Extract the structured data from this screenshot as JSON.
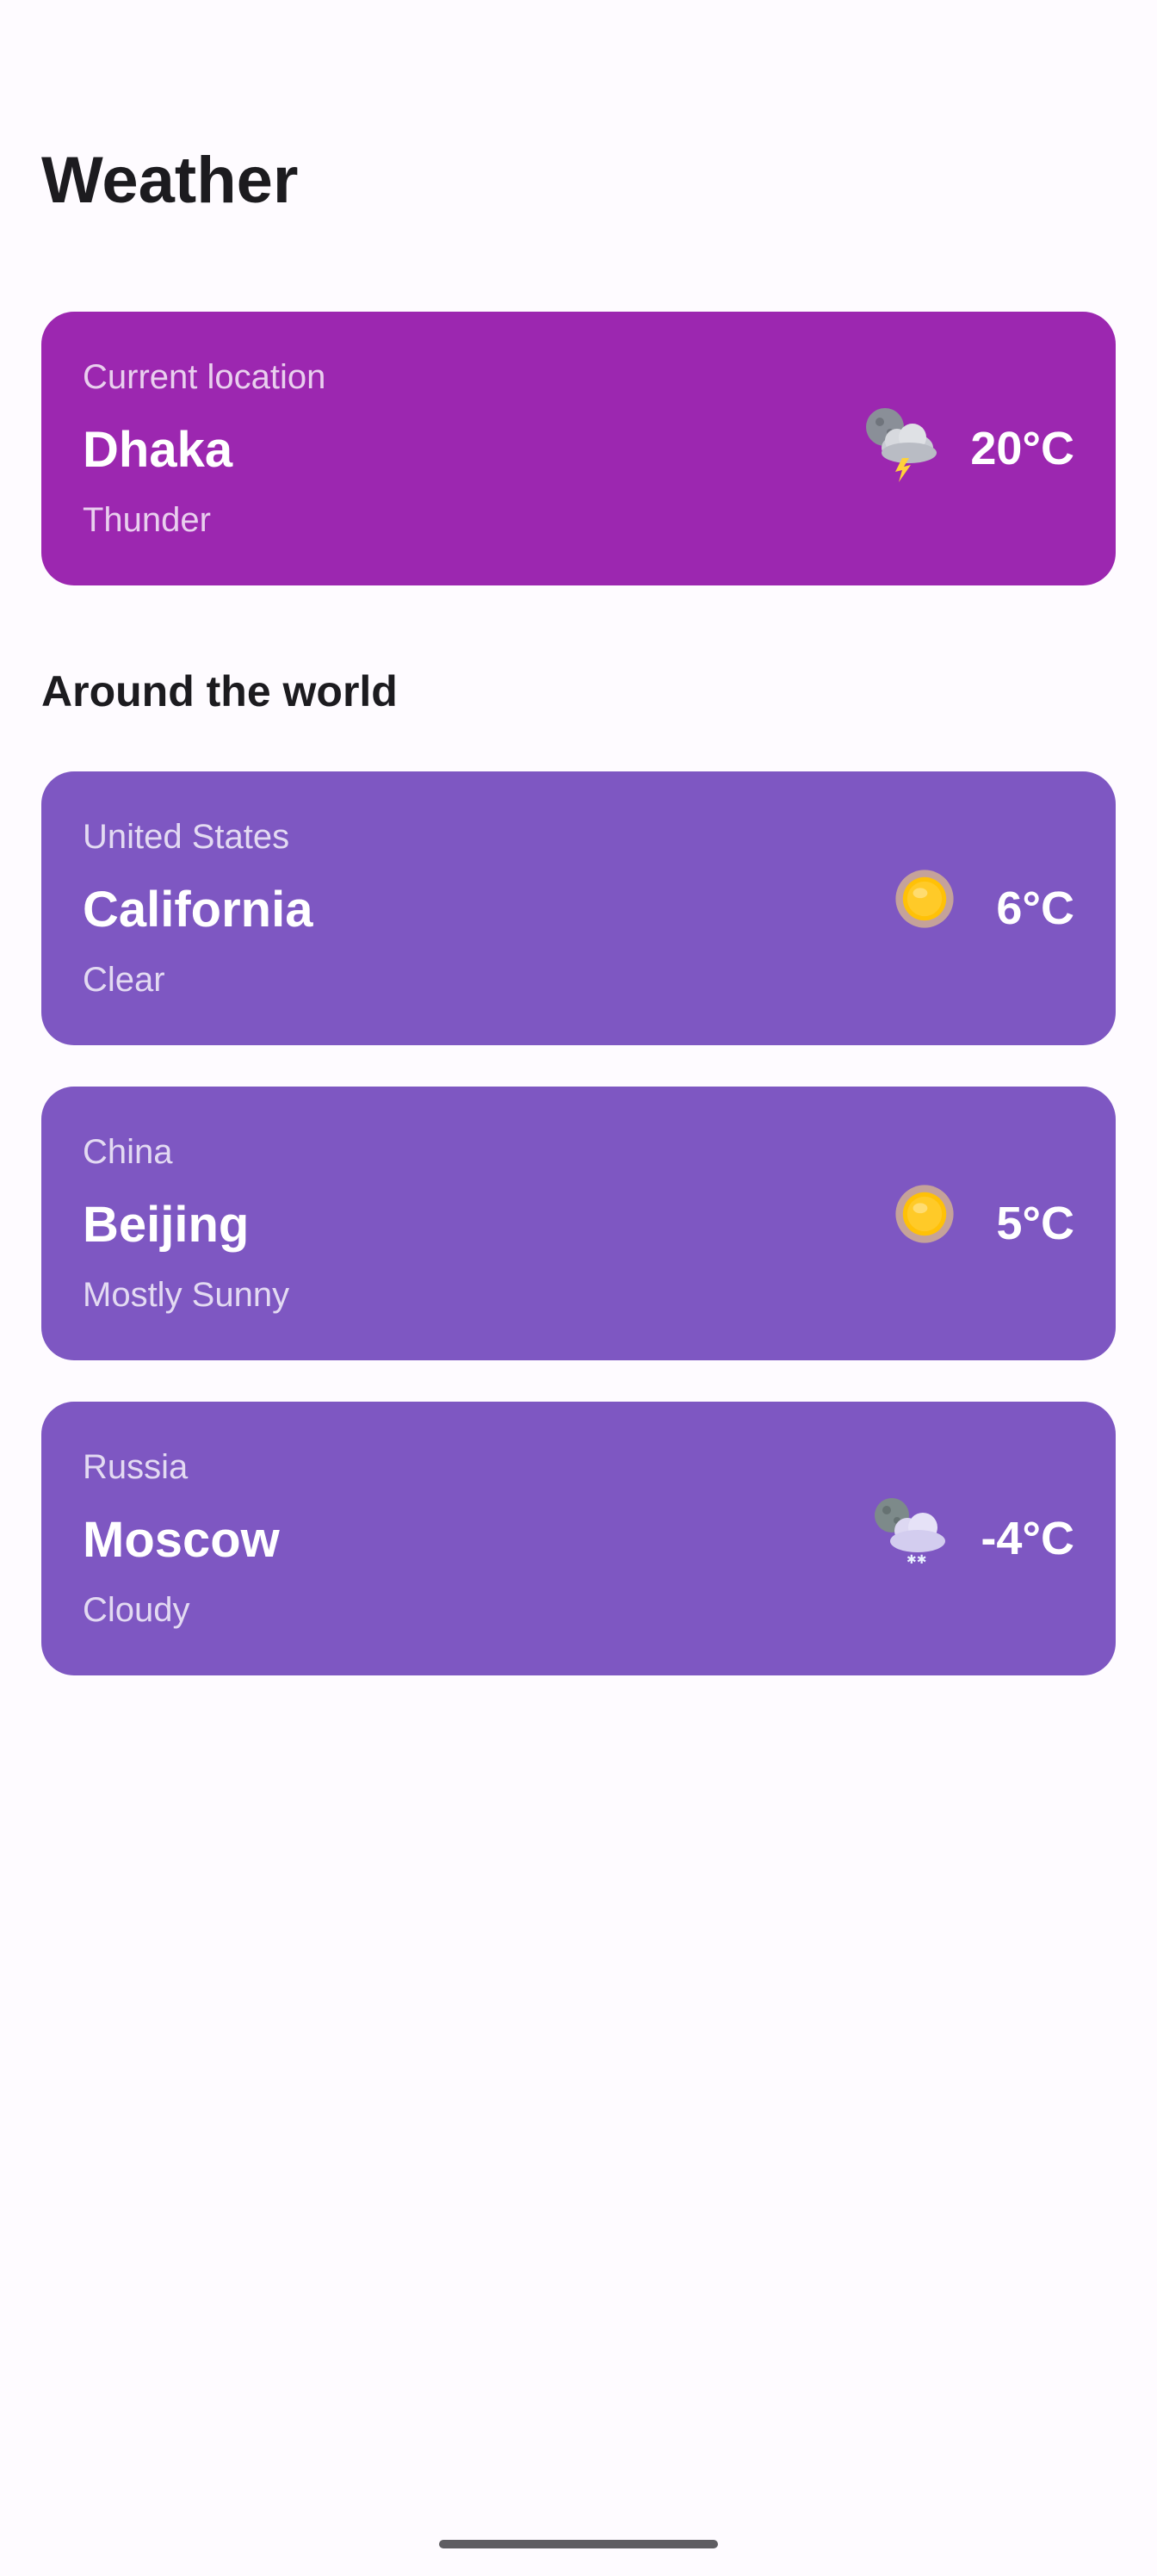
{
  "app": {
    "title": "Weather"
  },
  "current": {
    "label": "Current location",
    "city": "Dhaka",
    "condition": "Thunder",
    "temperature": "20°C",
    "icon": "thunder-cloud-icon",
    "color": "#9c27b0"
  },
  "world": {
    "title": "Around the world",
    "color": "#7e57c2",
    "cities": [
      {
        "country": "United States",
        "city": "California",
        "condition": "Clear",
        "temperature": "6°C",
        "icon": "sun-icon"
      },
      {
        "country": "China",
        "city": "Beijing",
        "condition": "Mostly Sunny",
        "temperature": "5°C",
        "icon": "sun-icon"
      },
      {
        "country": "Russia",
        "city": "Moscow",
        "condition": "Cloudy",
        "temperature": "-4°C",
        "icon": "snow-cloud-icon"
      }
    ]
  }
}
